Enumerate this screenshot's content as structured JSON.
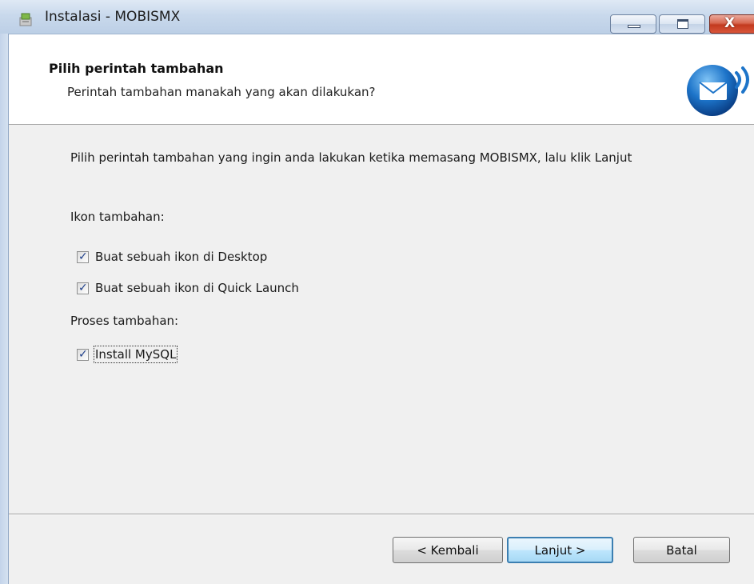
{
  "window": {
    "title": "Instalasi - MOBISMX",
    "controls": {
      "minimize": "minimize",
      "maximize": "maximize",
      "close": "X"
    }
  },
  "header": {
    "title": "Pilih perintah tambahan",
    "subtitle": "Perintah tambahan manakah yang akan dilakukan?",
    "logo_icon": "mail-signal-icon"
  },
  "content": {
    "intro": "Pilih perintah tambahan yang ingin anda lakukan ketika memasang MOBISMX, lalu klik Lanjut",
    "groups": [
      {
        "label": "Ikon tambahan:",
        "options": [
          {
            "label": "Buat sebuah ikon di Desktop",
            "checked": true
          },
          {
            "label": "Buat sebuah ikon di Quick Launch",
            "checked": true
          }
        ]
      },
      {
        "label": "Proses tambahan:",
        "options": [
          {
            "label": "Install MySQL",
            "checked": true,
            "focused": true
          }
        ]
      }
    ]
  },
  "buttons": {
    "back": "< Kembali",
    "next": "Lanjut >",
    "cancel": "Batal"
  },
  "colors": {
    "title_bar": "#c9d9ec",
    "header_bg": "#ffffff",
    "body_bg": "#f0f0f0",
    "checkmark": "#1f3f8a",
    "close_button": "#c23a1f"
  }
}
